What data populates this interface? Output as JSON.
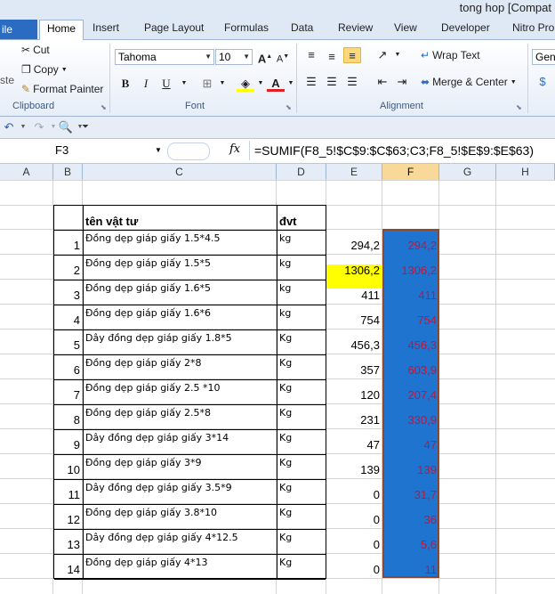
{
  "titlebar": {
    "title": "tong hop  [Compat"
  },
  "tabs": {
    "file": "ile",
    "items": [
      "Home",
      "Insert",
      "Page Layout",
      "Formulas",
      "Data",
      "Review",
      "View",
      "Developer",
      "Nitro Pro"
    ]
  },
  "ribbon": {
    "clipboard": {
      "cut": "Cut",
      "copy": "Copy",
      "format_painter": "Format Painter",
      "paste_fragment": "ste",
      "label": "Clipboard"
    },
    "font": {
      "name": "Tahoma",
      "size": "10",
      "bold": "B",
      "italic": "I",
      "underline": "U",
      "label": "Font"
    },
    "alignment": {
      "wrap_text": "Wrap Text",
      "merge_center": "Merge & Center",
      "label": "Alignment"
    },
    "number": {
      "format": "Gene"
    }
  },
  "formula_bar": {
    "name_box": "F3",
    "fx": "fx",
    "formula": "=SUMIF(F8_5!$C$9:$C$63;C3;F8_5!$E$9:$E$63)"
  },
  "columns": [
    "A",
    "B",
    "C",
    "D",
    "E",
    "F",
    "G",
    "H"
  ],
  "table": {
    "header": {
      "name": "tên vật tư",
      "unit": "đvt"
    },
    "rows": [
      {
        "no": "1",
        "name": "Đồng dẹp giáp giấy 1.5*4.5",
        "unit": "kg",
        "e": "294,2",
        "f": "294,2"
      },
      {
        "no": "2",
        "name": "Đồng dẹp giáp giấy 1.5*5",
        "unit": "kg",
        "e": "1306,2",
        "f": "1306,2"
      },
      {
        "no": "3",
        "name": "Đồng dẹp giáp giấy 1.6*5",
        "unit": "kg",
        "e": "411",
        "f": "411"
      },
      {
        "no": "4",
        "name": "Đồng dẹp giáp giấy 1.6*6",
        "unit": "kg",
        "e": "754",
        "f": "754"
      },
      {
        "no": "5",
        "name": "Dây đồng dẹp giáp giấy 1.8*5",
        "unit": "Kg",
        "e": "456,3",
        "f": "456,3"
      },
      {
        "no": "6",
        "name": "Đồng dẹp giáp giấy 2*8",
        "unit": "Kg",
        "e": "357",
        "f": "603,9"
      },
      {
        "no": "7",
        "name": "Đồng dẹp giáp giấy 2.5 *10",
        "unit": "Kg",
        "e": "120",
        "f": "207,4"
      },
      {
        "no": "8",
        "name": "Đồng dẹp giáp giấy 2.5*8",
        "unit": "Kg",
        "e": "231",
        "f": "330,9"
      },
      {
        "no": "9",
        "name": "Dây đồng dẹp giáp giấy 3*14",
        "unit": "Kg",
        "e": "47",
        "f": "47"
      },
      {
        "no": "10",
        "name": "Đồng dẹp giáp giấy 3*9",
        "unit": "Kg",
        "e": "139",
        "f": "139"
      },
      {
        "no": "11",
        "name": "Dây đồng dẹp giáp giấy 3.5*9",
        "unit": "Kg",
        "e": "0",
        "f": "31,7"
      },
      {
        "no": "12",
        "name": "Đồng dẹp giáp giấy 3.8*10",
        "unit": "Kg",
        "e": "0",
        "f": "36"
      },
      {
        "no": "13",
        "name": "Dây đồng dẹp giáp giấy 4*12.5",
        "unit": "Kg",
        "e": "0",
        "f": "5,6"
      },
      {
        "no": "14",
        "name": "Đồng dẹp giáp giấy 4*13",
        "unit": "Kg",
        "e": "0",
        "f": "11"
      }
    ]
  },
  "colors": {
    "selection": "#1f74d0",
    "highlight": "#ffff00",
    "red_text": "#c0163a",
    "file_tab": "#2a6cc1"
  }
}
